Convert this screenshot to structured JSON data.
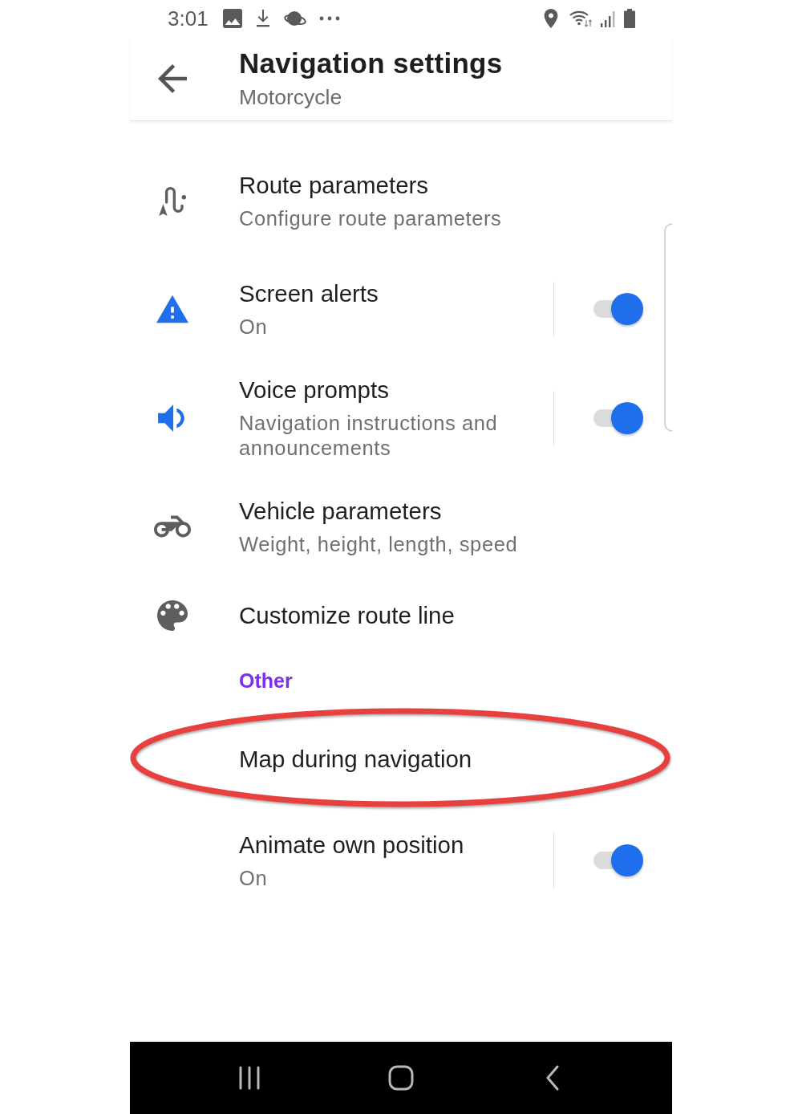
{
  "status_bar": {
    "time": "3:01"
  },
  "app_bar": {
    "title": "Navigation settings",
    "subtitle": "Motorcycle"
  },
  "sections": [
    {
      "items": [
        {
          "kind": "link",
          "title": "Route parameters",
          "summary": "Configure route parameters",
          "highlighted": false
        }
      ]
    },
    {
      "items": [
        {
          "kind": "switch",
          "title": "Screen alerts",
          "summary": "On",
          "on": true,
          "highlighted": false
        },
        {
          "kind": "switch",
          "title": "Voice prompts",
          "summary": "Navigation instructions and announcements",
          "on": true,
          "highlighted": false
        },
        {
          "kind": "link",
          "title": "Vehicle parameters",
          "summary": "Weight, height, length, speed",
          "highlighted": false
        },
        {
          "kind": "link",
          "title": "Customize route line",
          "highlighted": false
        }
      ]
    },
    {
      "header": "Other",
      "items": [
        {
          "kind": "link",
          "title": "Map during navigation",
          "highlighted": true
        }
      ]
    },
    {
      "items": [
        {
          "kind": "switch",
          "title": "Animate own position",
          "summary": "On",
          "on": true,
          "highlighted": false
        }
      ]
    }
  ]
}
